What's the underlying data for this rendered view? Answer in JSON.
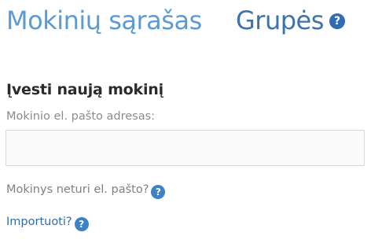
{
  "header": {
    "tabs": [
      {
        "label": "Mokinių sąrašas",
        "active": true
      },
      {
        "label": "Grupės",
        "active": false
      }
    ],
    "help_glyph": "?"
  },
  "form": {
    "title": "Įvesti naują mokinį",
    "email_label": "Mokinio el. pašto adresas:",
    "email_value": "",
    "email_placeholder": "",
    "no_email_text": "Mokinys neturi el. pašto?",
    "import_text": "Importuoti?",
    "help_glyph": "?"
  },
  "colors": {
    "tab_active": "#5b9bd5",
    "tab_link": "#3d73ad",
    "help_icon": "#2f6db0",
    "label": "#8c8c8c"
  },
  "icons": [
    "help-icon"
  ]
}
